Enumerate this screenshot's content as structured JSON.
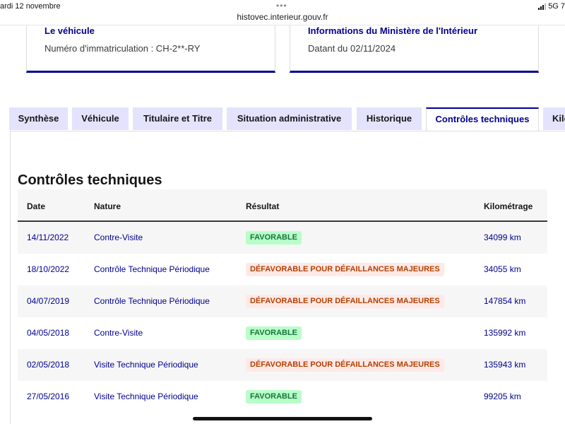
{
  "statusbar": {
    "date": "ardi 12 novembre",
    "dots": "•••",
    "url": "histovec.interieur.gouv.fr",
    "network": "5G",
    "battery_partial": "7"
  },
  "cards": {
    "vehicle": {
      "title": "Le véhicule",
      "text": "Numéro d'immatriculation : CH-2**-RY"
    },
    "ministry": {
      "title": "Informations du Ministère de l'Intérieur",
      "text": "Datant du 02/11/2024"
    }
  },
  "tabs": [
    {
      "label": "Synthèse"
    },
    {
      "label": "Véhicule"
    },
    {
      "label": "Titulaire et Titre"
    },
    {
      "label": "Situation administrative"
    },
    {
      "label": "Historique"
    },
    {
      "label": "Contrôles techniques"
    },
    {
      "label": "Kilo"
    }
  ],
  "active_tab": "Contrôles techniques",
  "section": {
    "title": "Contrôles techniques"
  },
  "table": {
    "headers": {
      "date": "Date",
      "nature": "Nature",
      "result": "Résultat",
      "km": "Kilométrage"
    },
    "rows": [
      {
        "date": "14/11/2022",
        "nature": "Contre-Visite",
        "result": "FAVORABLE",
        "status": "ok",
        "km": "34099 km"
      },
      {
        "date": "18/10/2022",
        "nature": "Contrôle Technique Périodique",
        "result": "DÉFAVORABLE POUR DÉFAILLANCES MAJEURES",
        "status": "ko",
        "km": "34055 km"
      },
      {
        "date": "04/07/2019",
        "nature": "Contrôle Technique Périodique",
        "result": "DÉFAVORABLE POUR DÉFAILLANCES MAJEURES",
        "status": "ko",
        "km": "147854 km"
      },
      {
        "date": "04/05/2018",
        "nature": "Contre-Visite",
        "result": "FAVORABLE",
        "status": "ok",
        "km": "135992 km"
      },
      {
        "date": "02/05/2018",
        "nature": "Visite Technique Périodique",
        "result": "DÉFAVORABLE POUR DÉFAILLANCES MAJEURES",
        "status": "ko",
        "km": "135943 km"
      },
      {
        "date": "27/05/2016",
        "nature": "Visite Technique Périodique",
        "result": "FAVORABLE",
        "status": "ok",
        "km": "99205 km"
      }
    ]
  },
  "colors": {
    "primary_blue": "#000091",
    "tab_bg": "#e3e3fd",
    "success_bg": "#b8fec9",
    "success_text": "#18753c",
    "error_bg": "#ffe9e6",
    "error_text": "#b34000"
  }
}
